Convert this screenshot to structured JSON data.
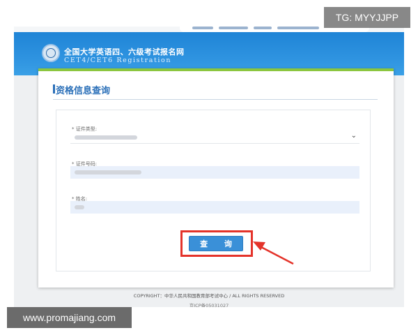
{
  "header": {
    "title": "全国大学英语四、六级考试报名网",
    "subtitle": "CET4/CET6  Registration"
  },
  "card": {
    "title": "资格信息查询"
  },
  "form": {
    "fields": [
      {
        "label": "* 证件类型:",
        "value": ""
      },
      {
        "label": "* 证件号码:",
        "value": ""
      },
      {
        "label": "* 姓名:",
        "value": ""
      }
    ],
    "submit_label": "查 询"
  },
  "footer": {
    "copyright": "COPYRIGHT：中华人民共和国教育部考试中心 / ALL RIGHTS RESERVED",
    "icp": "京ICP备05031027"
  },
  "watermarks": {
    "tg": "TG: MYYJJPP",
    "url": "www.promajiang.com"
  },
  "colors": {
    "header_blue": "#2e93e0",
    "accent_green": "#8cc63f",
    "button_blue": "#3a90d8",
    "highlight_red": "#e4332a"
  }
}
